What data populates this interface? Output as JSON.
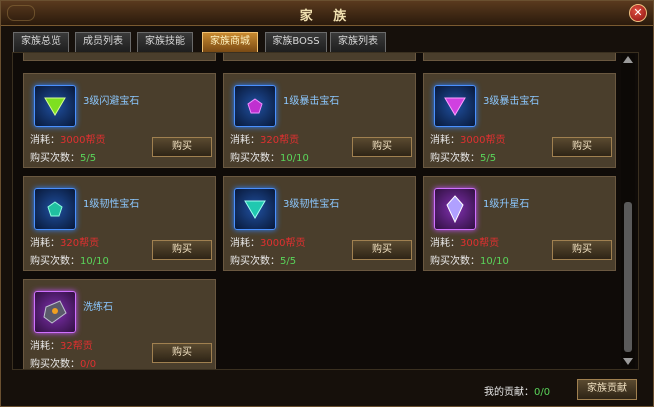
{
  "window": {
    "title": "家 族"
  },
  "tabs": [
    {
      "label": "家族总览"
    },
    {
      "label": "成员列表"
    },
    {
      "label": "家族技能"
    },
    {
      "label": "家族商城"
    },
    {
      "label": "家族BOSS"
    },
    {
      "label": "家族列表"
    }
  ],
  "active_tab": "家族商城",
  "items": [
    {
      "name": "3级闪避宝石",
      "cost_label": "消耗：",
      "cost_value": "3000帮贡",
      "count_label": "购买次数：",
      "count_value": "5/5",
      "buy_label": "购买",
      "icon": "green-triangle-gem-icon",
      "frame": "blue"
    },
    {
      "name": "1级暴击宝石",
      "cost_label": "消耗：",
      "cost_value": "320帮贡",
      "count_label": "购买次数：",
      "count_value": "10/10",
      "buy_label": "购买",
      "icon": "purple-gem-icon",
      "frame": "blue"
    },
    {
      "name": "3级暴击宝石",
      "cost_label": "消耗：",
      "cost_value": "3000帮贡",
      "count_label": "购买次数：",
      "count_value": "5/5",
      "buy_label": "购买",
      "icon": "purple-triangle-gem-icon",
      "frame": "blue"
    },
    {
      "name": "1级韧性宝石",
      "cost_label": "消耗：",
      "cost_value": "320帮贡",
      "count_label": "购买次数：",
      "count_value": "10/10",
      "buy_label": "购买",
      "icon": "teal-gem-icon",
      "frame": "blue"
    },
    {
      "name": "3级韧性宝石",
      "cost_label": "消耗：",
      "cost_value": "3000帮贡",
      "count_label": "购买次数：",
      "count_value": "5/5",
      "buy_label": "购买",
      "icon": "teal-triangle-gem-icon",
      "frame": "blue"
    },
    {
      "name": "1级升星石",
      "cost_label": "消耗：",
      "cost_value": "300帮贡",
      "count_label": "购买次数：",
      "count_value": "10/10",
      "buy_label": "购买",
      "icon": "star-crystal-icon",
      "frame": "purple"
    },
    {
      "name": "洗练石",
      "cost_label": "消耗：",
      "cost_value": "32帮贡",
      "count_label": "购买次数：",
      "count_value": "0/0",
      "buy_label": "购买",
      "icon": "refine-stone-icon",
      "frame": "purple"
    }
  ],
  "footer": {
    "contribution_label": "我的贡献：",
    "contribution_value": "0/0",
    "button_label": "家族贡献"
  },
  "colors": {
    "cost": "#e03030",
    "count": "#5ad45a",
    "item_name": "#8cc8ff",
    "active_tab": "#c88a30"
  }
}
